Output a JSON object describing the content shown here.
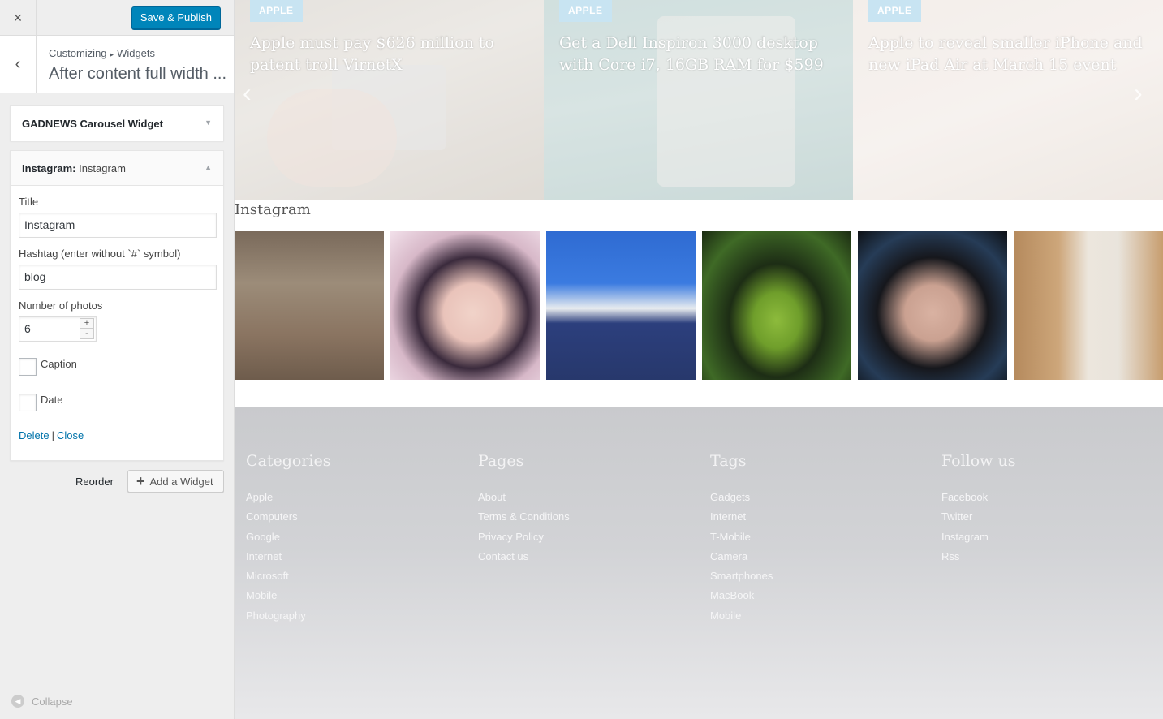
{
  "customizer": {
    "close_icon": "×",
    "save_label": "Save & Publish",
    "back_icon": "‹",
    "breadcrumb": {
      "root": "Customizing",
      "sep": "▸",
      "section": "Widgets"
    },
    "section_title": "After content full width ...",
    "widgets": {
      "carousel": {
        "title": "GADNEWS Carousel Widget",
        "arrow": "▼"
      },
      "instagram": {
        "title": "Instagram:",
        "subtitle": "Instagram",
        "arrow": "▲",
        "fields": {
          "title_label": "Title",
          "title_value": "Instagram",
          "hashtag_label": "Hashtag (enter without `#` symbol)",
          "hashtag_value": "blog",
          "photos_label": "Number of photos",
          "photos_value": "6",
          "step_up": "+",
          "step_down": "-",
          "caption_label": "Caption",
          "date_label": "Date"
        },
        "delete_label": "Delete",
        "link_sep": "|",
        "close_label": "Close"
      }
    },
    "reorder_label": "Reorder",
    "add_widget_icon": "+",
    "add_widget_label": "Add a Widget",
    "collapse_icon": "◀",
    "collapse_label": "Collapse"
  },
  "preview": {
    "carousel": {
      "slides": [
        {
          "tag": "APPLE",
          "headline": "Apple must pay $626 million to patent troll VirnetX"
        },
        {
          "tag": "APPLE",
          "headline": "Get a Dell Inspiron 3000 desktop with Core i7, 16GB RAM for $599"
        },
        {
          "tag": "APPLE",
          "headline": "Apple to reveal smaller iPhone and new iPad Air at March 15 event"
        }
      ],
      "prev_icon": "‹",
      "next_icon": "›"
    },
    "instagram_title": "Instagram",
    "footer": {
      "columns": [
        {
          "heading": "Categories",
          "links": [
            "Apple",
            "Computers",
            "Google",
            "Internet",
            "Microsoft",
            "Mobile",
            "Photography"
          ]
        },
        {
          "heading": "Pages",
          "links": [
            "About",
            "Terms & Conditions",
            "Privacy Policy",
            "Contact us"
          ]
        },
        {
          "heading": "Tags",
          "links": [
            "Gadgets",
            "Internet",
            "T-Mobile",
            "Camera",
            "Smartphones",
            "MacBook",
            "Mobile"
          ]
        },
        {
          "heading": "Follow us",
          "links": [
            "Facebook",
            "Twitter",
            "Instagram",
            "Rss"
          ]
        }
      ]
    }
  },
  "colors": {
    "primary_button": "#0085ba",
    "link": "#0073aa",
    "tag_bg": "#c8e4f2",
    "footer_bg": "#c9cacd"
  }
}
